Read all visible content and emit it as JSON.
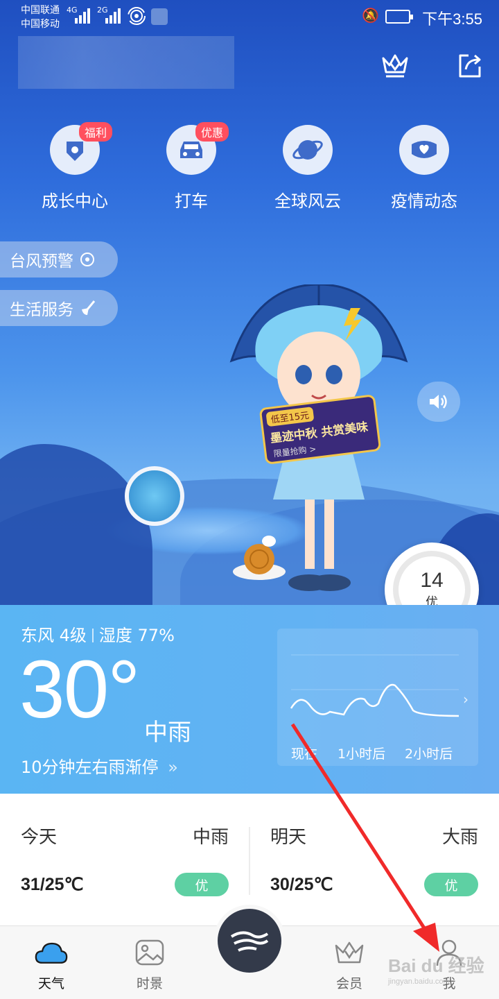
{
  "status_bar": {
    "carrier1": "中国联通",
    "carrier2": "中国移动",
    "net1": "4G",
    "net2": "2G",
    "time": "下午3:55"
  },
  "header": {
    "vip_icon": "crown-icon",
    "share_icon": "share-icon"
  },
  "features": [
    {
      "label": "成长中心",
      "badge": "福利",
      "icon": "shield-star-icon"
    },
    {
      "label": "打车",
      "badge": "优惠",
      "icon": "car-icon"
    },
    {
      "label": "全球风云",
      "badge": "",
      "icon": "planet-icon"
    },
    {
      "label": "疫情动态",
      "badge": "",
      "icon": "mask-icon"
    }
  ],
  "side_pills": [
    {
      "label": "台风预警",
      "icon": "typhoon-icon"
    },
    {
      "label": "生活服务",
      "icon": "broom-icon"
    }
  ],
  "promo": {
    "line1": "低至15元",
    "line2": "墨迹中秋 共赏美味",
    "line3": "限量抢购 >"
  },
  "aqi": {
    "value": "14",
    "level": "优",
    "color": "#2fbf7a"
  },
  "current": {
    "wind": "东风 4级",
    "humidity": "湿度 77%",
    "temperature": "30°",
    "condition": "中雨",
    "hint": "10分钟左右雨渐停",
    "rain_labels": [
      "现在",
      "1小时后",
      "2小时后"
    ]
  },
  "forecast": [
    {
      "day": "今天",
      "condition": "中雨",
      "range": "31/25℃",
      "aq": "优"
    },
    {
      "day": "明天",
      "condition": "大雨",
      "range": "30/25℃",
      "aq": "优"
    }
  ],
  "tabs": [
    {
      "label": "天气",
      "icon": "cloud-icon"
    },
    {
      "label": "时景",
      "icon": "photo-icon"
    },
    {
      "label": "会员",
      "icon": "crown-icon"
    },
    {
      "label": "我",
      "icon": "user-icon"
    }
  ],
  "watermark": {
    "main": "Bai du 经验",
    "sub": "jingyan.baidu.com"
  },
  "colors": {
    "accent_red": "#ff4f5e",
    "aq_green": "#5ed0a3",
    "arrow_red": "#f02a2a"
  }
}
